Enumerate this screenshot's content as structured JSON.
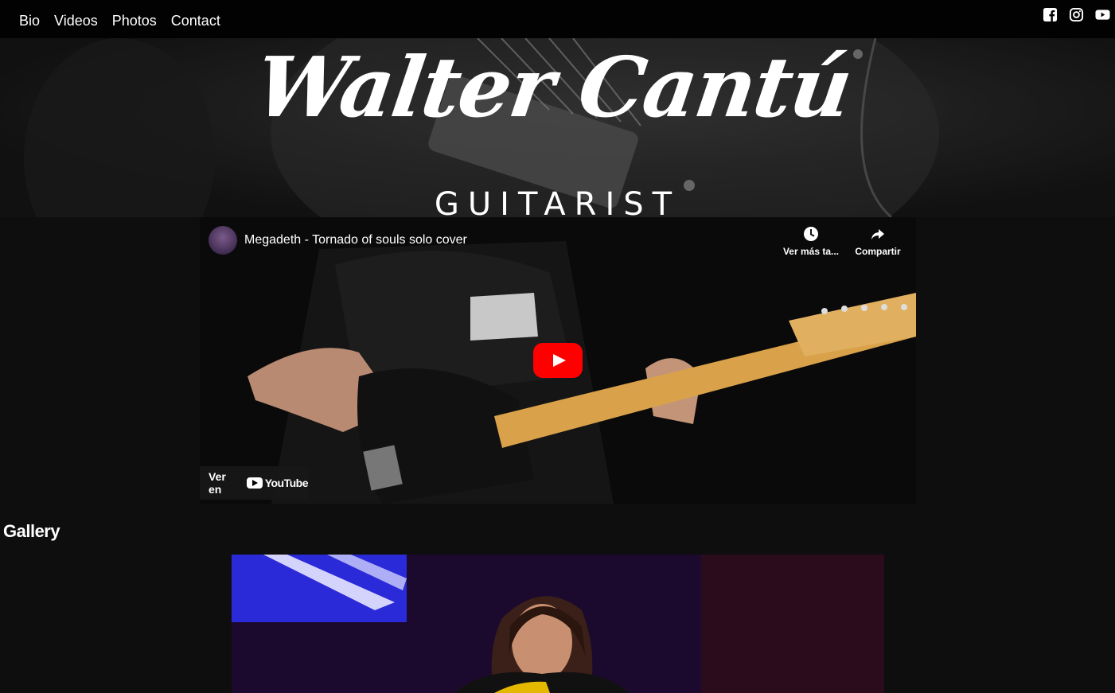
{
  "nav": {
    "items": [
      {
        "label": "Bio"
      },
      {
        "label": "Videos"
      },
      {
        "label": "Photos"
      },
      {
        "label": "Contact"
      }
    ]
  },
  "social": {
    "icons": [
      "facebook-icon",
      "instagram-icon",
      "youtube-icon"
    ]
  },
  "hero": {
    "title": "Walter Cantú",
    "subtitle": "GUITARIST"
  },
  "video": {
    "title": "Megadeth - Tornado of souls solo cover",
    "watch_later_label": "Ver más ta...",
    "share_label": "Compartir",
    "watch_on_label": "Ver en",
    "youtube_logo_text": "YouTube"
  },
  "gallery": {
    "heading": "Gallery"
  },
  "colors": {
    "topbar": "#020202",
    "page_bg": "#0e0e0e",
    "play_button": "#ff0000"
  }
}
